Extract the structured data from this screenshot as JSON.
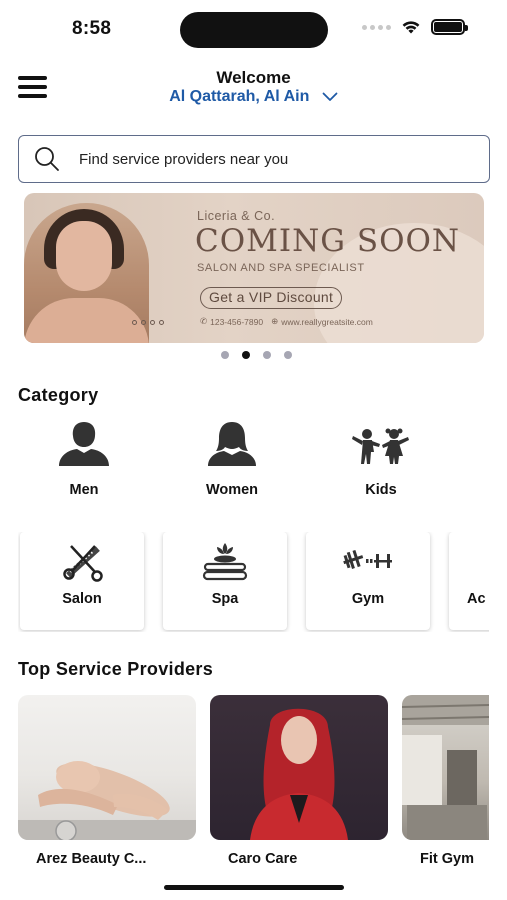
{
  "status_bar": {
    "time": "8:58"
  },
  "header": {
    "title": "Welcome",
    "location": "Al Qattarah, Al Ain"
  },
  "search": {
    "placeholder": "Find service providers near you"
  },
  "banner": {
    "brand": "Liceria & Co.",
    "title": "COMING SOON",
    "subtitle": "SALON AND SPA SPECIALIST",
    "cta": "Get a VIP Discount",
    "phone": "123-456-7890",
    "website": "www.reallygreatsite.com",
    "page_count": 4,
    "active_page": 1
  },
  "category": {
    "title": "Category",
    "items": [
      {
        "label": "Men",
        "icon": "man-icon"
      },
      {
        "label": "Women",
        "icon": "woman-icon"
      },
      {
        "label": "Kids",
        "icon": "kids-icon"
      }
    ]
  },
  "services": {
    "items": [
      {
        "label": "Salon",
        "icon": "scissors-comb-icon"
      },
      {
        "label": "Spa",
        "icon": "spa-stones-icon"
      },
      {
        "label": "Gym",
        "icon": "dumbbell-icon"
      },
      {
        "label": "Ac",
        "icon": "activity-icon"
      }
    ]
  },
  "providers": {
    "title": "Top Service Providers",
    "items": [
      {
        "name": "Arez Beauty C..."
      },
      {
        "name": "Caro Care"
      },
      {
        "name": "Fit Gym"
      }
    ]
  },
  "colors": {
    "accent": "#1f5aa6",
    "text": "#111111",
    "banner_bg": "#dccabd"
  }
}
